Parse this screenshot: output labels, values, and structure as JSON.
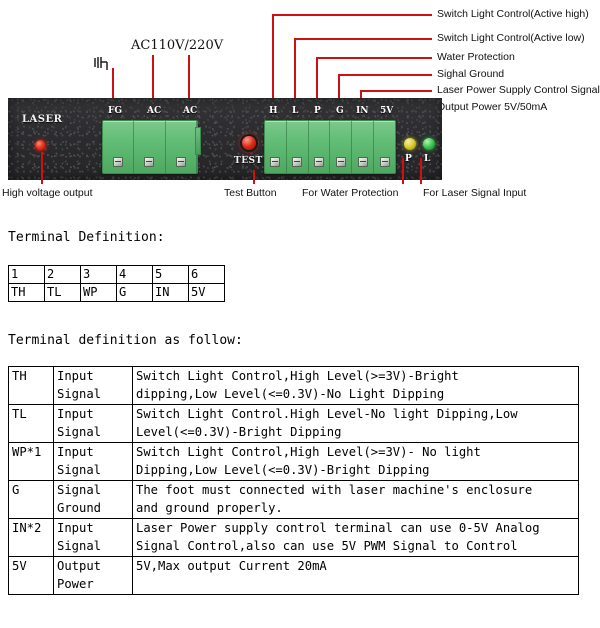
{
  "diagram": {
    "panel": {
      "laser_label": "LASER",
      "test_label": "TEST",
      "ac_label": "AC110V/220V",
      "power_pins": [
        "FG",
        "AC",
        "AC"
      ],
      "signal_pins": [
        "H",
        "L",
        "P",
        "G",
        "IN",
        "5V"
      ],
      "led_p_label": "P",
      "led_l_label": "L"
    },
    "callouts": [
      "Switch Light Control(Active high)",
      "Switch Light Control(Active low)",
      "Water Protection",
      "Sighal Ground",
      "Laser Power Supply Control Signal",
      "Output Power 5V/50mA"
    ],
    "captions": [
      "High voltage output",
      "Test Button",
      "For Water Protection",
      "For Laser Signal Input"
    ]
  },
  "headings": {
    "terminal_definition": "Terminal Definition:",
    "definition_follow": "Terminal definition as follow:"
  },
  "pin_table": {
    "numbers": [
      "1",
      "2",
      "3",
      "4",
      "5",
      "6"
    ],
    "names": [
      "TH",
      "TL",
      "WP",
      "G",
      "IN",
      "5V"
    ]
  },
  "definition_table": {
    "rows": [
      {
        "name": "TH",
        "type_line1": "Input",
        "type_line2": "Signal",
        "desc_line1": "Switch Light Control,High Level(>=3V)-Bright",
        "desc_line2": "dipping,Low Level(<=0.3V)-No Light Dipping"
      },
      {
        "name": "TL",
        "type_line1": "Input",
        "type_line2": "Signal",
        "desc_line1": "Switch Light Control.High Level-No light Dipping,Low",
        "desc_line2": "Level(<=0.3V)-Bright Dipping"
      },
      {
        "name": "WP*1",
        "type_line1": "Input",
        "type_line2": "Signal",
        "desc_line1": "Switch Light Control,High Level(>=3V)- No light",
        "desc_line2": "Dipping,Low Level(<=0.3V)-Bright Dipping"
      },
      {
        "name": "G",
        "type_line1": "Signal",
        "type_line2": "Ground",
        "desc_line1": "The foot must connected with laser machine's enclosure",
        "desc_line2": "and ground properly."
      },
      {
        "name": "IN*2",
        "type_line1": "Input",
        "type_line2": "Signal",
        "desc_line1": "Laser Power supply control terminal can use 0-5V Analog",
        "desc_line2": "Signal Control,also can use 5V PWM Signal to Control"
      },
      {
        "name": "5V",
        "type_line1": "Output",
        "type_line2": "Power",
        "desc_line1": "5V,Max output Current 20mA",
        "desc_line2": ""
      }
    ]
  },
  "colors": {
    "leader_red": "#cc1111",
    "terminal_green": "#62bd76",
    "panel_dark": "#2a2a2c",
    "led_red": "#e8321d",
    "led_yellow": "#d8cb2c",
    "led_green": "#3cc44a"
  }
}
